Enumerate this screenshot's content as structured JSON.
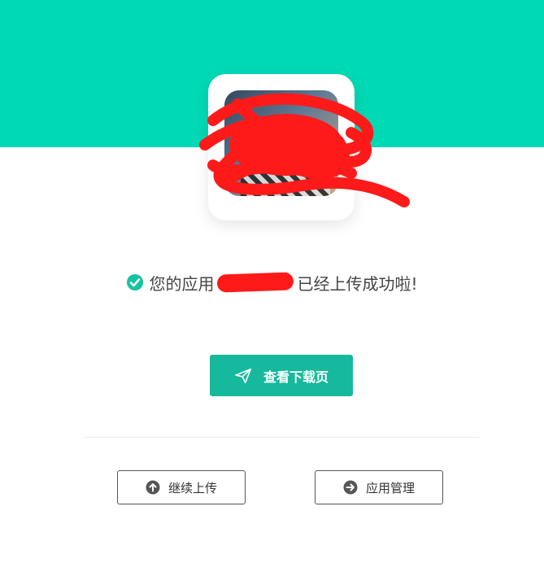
{
  "success": {
    "prefix": "您的应用",
    "suffix": "已经上传成功啦!"
  },
  "actions": {
    "view_download_label": "查看下载页",
    "continue_upload_label": "继续上传",
    "app_manage_label": "应用管理"
  },
  "colors": {
    "banner": "#00d9b5",
    "primary_button": "#16b99b",
    "check_icon": "#17c2a2",
    "redaction": "#ff1a1a"
  },
  "icons": {
    "success": "check-circle-icon",
    "view_download": "paper-plane-icon",
    "continue_upload": "arrow-up-circle-icon",
    "app_manage": "arrow-right-circle-icon"
  }
}
